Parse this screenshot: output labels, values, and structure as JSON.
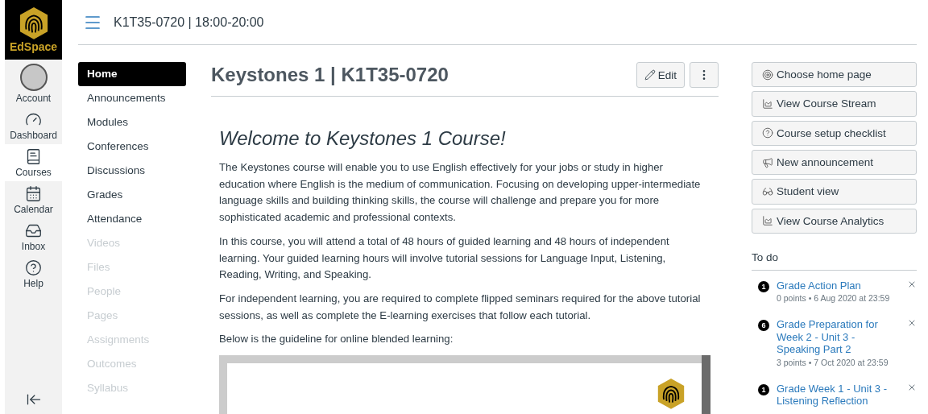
{
  "logo": {
    "text": "EdSpace"
  },
  "global_nav": [
    {
      "kind": "avatar",
      "label": "Account",
      "selected": false
    },
    {
      "kind": "dashboard",
      "label": "Dashboard",
      "selected": false
    },
    {
      "kind": "courses",
      "label": "Courses",
      "selected": true
    },
    {
      "kind": "calendar",
      "label": "Calendar",
      "selected": false
    },
    {
      "kind": "inbox",
      "label": "Inbox",
      "selected": false
    },
    {
      "kind": "help",
      "label": "Help",
      "selected": false
    }
  ],
  "header": {
    "title": "K1T35-0720 | 18:00-20:00"
  },
  "course_nav": [
    {
      "label": "Home",
      "selected": true,
      "disabled": false
    },
    {
      "label": "Announcements",
      "selected": false,
      "disabled": false
    },
    {
      "label": "Modules",
      "selected": false,
      "disabled": false
    },
    {
      "label": "Conferences",
      "selected": false,
      "disabled": false
    },
    {
      "label": "Discussions",
      "selected": false,
      "disabled": false
    },
    {
      "label": "Grades",
      "selected": false,
      "disabled": false
    },
    {
      "label": "Attendance",
      "selected": false,
      "disabled": false
    },
    {
      "label": "Videos",
      "selected": false,
      "disabled": true
    },
    {
      "label": "Files",
      "selected": false,
      "disabled": true
    },
    {
      "label": "People",
      "selected": false,
      "disabled": true
    },
    {
      "label": "Pages",
      "selected": false,
      "disabled": true
    },
    {
      "label": "Assignments",
      "selected": false,
      "disabled": true
    },
    {
      "label": "Outcomes",
      "selected": false,
      "disabled": true
    },
    {
      "label": "Syllabus",
      "selected": false,
      "disabled": true
    }
  ],
  "page": {
    "title": "Keystones 1 | K1T35-0720",
    "edit_button": "Edit",
    "heading": "Welcome to Keystones 1 Course!",
    "paragraphs": [
      "The Keystones course will enable you to use English effectively for your jobs or study in higher education where English is the medium of communication. Focusing on developing upper-intermediate language skills and building thinking skills, the course will challenge and prepare you for more sophisticated academic and professional contexts.",
      "In this course, you will attend a total of 48 hours of guided learning and 48 hours of independent learning. Your guided learning hours will involve tutorial sessions for Language Input, Listening, Reading, Writing, and Speaking.",
      "For independent learning, you are required to complete flipped seminars required for the above tutorial sessions, as well as complete the E-learning exercises that follow each tutorial.",
      "Below is the guideline for online blended learning:"
    ]
  },
  "sidebar_buttons": [
    {
      "kind": "target",
      "label": "Choose home page"
    },
    {
      "kind": "chart",
      "label": "View Course Stream"
    },
    {
      "kind": "help",
      "label": "Course setup checklist"
    },
    {
      "kind": "megaphone",
      "label": "New announcement"
    },
    {
      "kind": "glasses",
      "label": "Student view"
    },
    {
      "kind": "chart",
      "label": "View Course Analytics"
    }
  ],
  "todo": {
    "title": "To do",
    "items": [
      {
        "count": "1",
        "title": "Grade Action Plan",
        "meta": "0 points • 6 Aug 2020 at 23:59"
      },
      {
        "count": "6",
        "title": "Grade Preparation for Week 2 - Unit 3 - Speaking Part 2",
        "meta": "3 points • 7 Oct 2020 at 23:59"
      },
      {
        "count": "1",
        "title": "Grade Week 1 - Unit 3 - Listening Reflection"
      }
    ]
  }
}
